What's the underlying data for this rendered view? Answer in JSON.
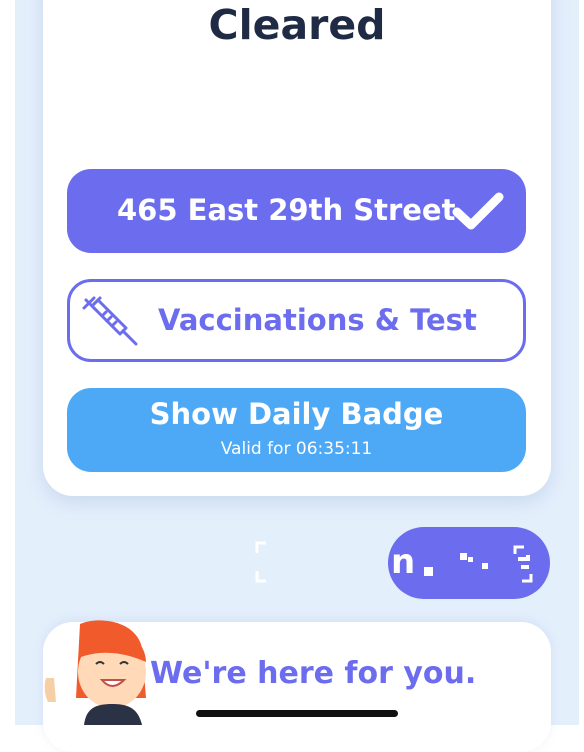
{
  "status": {
    "title": "Cleared"
  },
  "actions": {
    "location_label": "465 East 29th Street",
    "vaccinations_label": "Vaccinations & Test",
    "badge_label": "Show Daily Badge",
    "badge_validity": "Valid for 06:35:11"
  },
  "scan": {
    "pill_partial_text": "n"
  },
  "help": {
    "text": "We're here for you."
  },
  "colors": {
    "primary": "#6b6cee",
    "badge": "#4da9f5",
    "title": "#1f2a44",
    "background": "#e4effc"
  },
  "icons": {
    "check": "check-icon",
    "syringe": "syringe-icon",
    "qr_scan": "qr-scan-icon",
    "mascot": "mascot-avatar"
  }
}
